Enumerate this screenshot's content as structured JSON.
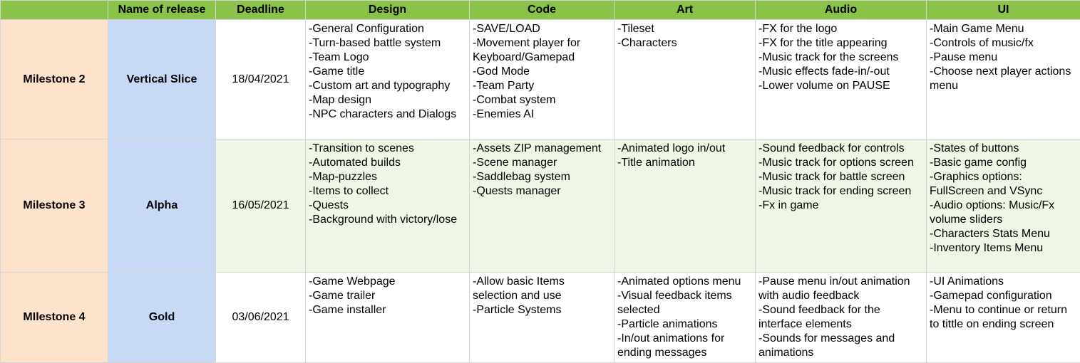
{
  "header": {
    "milestone": "",
    "release": "Name of release",
    "deadline": "Deadline",
    "design": "Design",
    "code": "Code",
    "art": "Art",
    "audio": "Audio",
    "ui": "UI"
  },
  "colors": {
    "header_bg": "#8bc34a",
    "milestone_bg": "#fde3cb",
    "release_bg": "#c8d9f5",
    "alt_row_bg": "#eef6e6"
  },
  "rows": [
    {
      "milestone": "Milestone 2",
      "release": "Vertical Slice",
      "deadline": "18/04/2021",
      "design": [
        "-General Configuration",
        "-Turn-based battle system",
        "-Team Logo",
        "-Game title",
        "-Custom art and typography",
        "-Map design",
        "-NPC characters and Dialogs"
      ],
      "code": [
        "-SAVE/LOAD",
        "-Movement player for Keyboard/Gamepad",
        "-God Mode",
        "-Team Party",
        "-Combat system",
        "-Enemies AI"
      ],
      "art": [
        "-Tileset",
        "-Characters"
      ],
      "audio": [
        "-FX for the logo",
        "-FX for the title appearing",
        "-Music track for the screens",
        "-Music effects fade-in/-out",
        "-Lower volume on PAUSE"
      ],
      "ui": [
        "-Main Game Menu",
        "-Controls of music/fx",
        "-Pause menu",
        "-Choose next player actions menu"
      ]
    },
    {
      "milestone": "Milestone 3",
      "release": "Alpha",
      "deadline": "16/05/2021",
      "design": [
        "-Transition to scenes",
        "-Automated builds",
        "-Map-puzzles",
        "-Items to collect",
        "-Quests",
        "-Background with victory/lose"
      ],
      "code": [
        "-Assets ZIP management",
        "-Scene manager",
        "-Saddlebag system",
        "-Quests manager"
      ],
      "art": [
        "-Animated logo in/out",
        "-Title animation"
      ],
      "audio": [
        "-Sound feedback for controls",
        "-Music track for options screen",
        "-Music track for battle screen",
        "-Music track for ending screen",
        "-Fx in game"
      ],
      "ui": [
        "-States of buttons",
        "-Basic game config",
        "-Graphics options: FullScreen and VSync",
        "-Audio options: Music/Fx volume sliders",
        "-Characters Stats Menu",
        "-Inventory Items Menu"
      ]
    },
    {
      "milestone": "MIlestone 4",
      "release": "Gold",
      "deadline": "03/06/2021",
      "design": [
        "-Game Webpage",
        "-Game trailer",
        "-Game installer"
      ],
      "code": [
        "-Allow basic Items selection and use",
        "-Particle Systems"
      ],
      "art": [
        "-Animated options menu",
        "-Visual feedback items selected",
        "-Particle animations",
        "-In/out animations for ending messages"
      ],
      "audio": [
        "-Pause menu in/out animation with audio feedback",
        "-Sound feedback for the interface elements",
        "-Sounds for messages and animations"
      ],
      "ui": [
        "-UI Animations",
        "-Gamepad configuration",
        "-Menu to continue or return to tittle on ending screen"
      ]
    }
  ]
}
